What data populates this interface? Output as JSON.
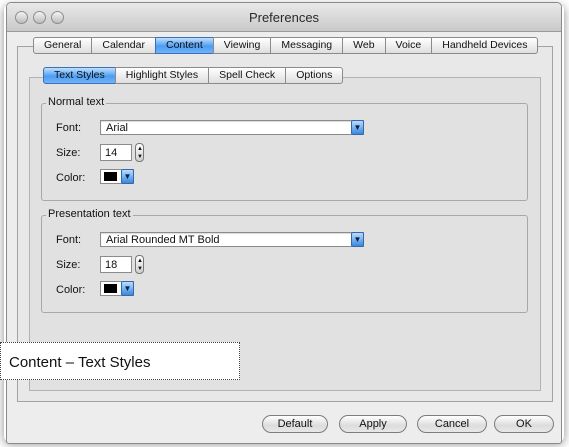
{
  "window": {
    "title": "Preferences"
  },
  "top_tabs": [
    {
      "label": "General"
    },
    {
      "label": "Calendar"
    },
    {
      "label": "Content",
      "active": true
    },
    {
      "label": "Viewing"
    },
    {
      "label": "Messaging"
    },
    {
      "label": "Web"
    },
    {
      "label": "Voice"
    },
    {
      "label": "Handheld Devices"
    }
  ],
  "sub_tabs": [
    {
      "label": "Text Styles",
      "active": true
    },
    {
      "label": "Highlight Styles"
    },
    {
      "label": "Spell Check"
    },
    {
      "label": "Options"
    }
  ],
  "normal_text": {
    "group_label": "Normal text",
    "font_label": "Font:",
    "font_value": "Arial",
    "size_label": "Size:",
    "size_value": "14",
    "color_label": "Color:",
    "color_value": "#000000"
  },
  "presentation_text": {
    "group_label": "Presentation text",
    "font_label": "Font:",
    "font_value": "Arial Rounded MT Bold",
    "size_label": "Size:",
    "size_value": "18",
    "color_label": "Color:",
    "color_value": "#000000"
  },
  "caption": "Content – Text Styles",
  "buttons": {
    "default": "Default",
    "apply": "Apply",
    "cancel": "Cancel",
    "ok": "OK"
  },
  "colors": {
    "accent": "#4d9df2"
  }
}
